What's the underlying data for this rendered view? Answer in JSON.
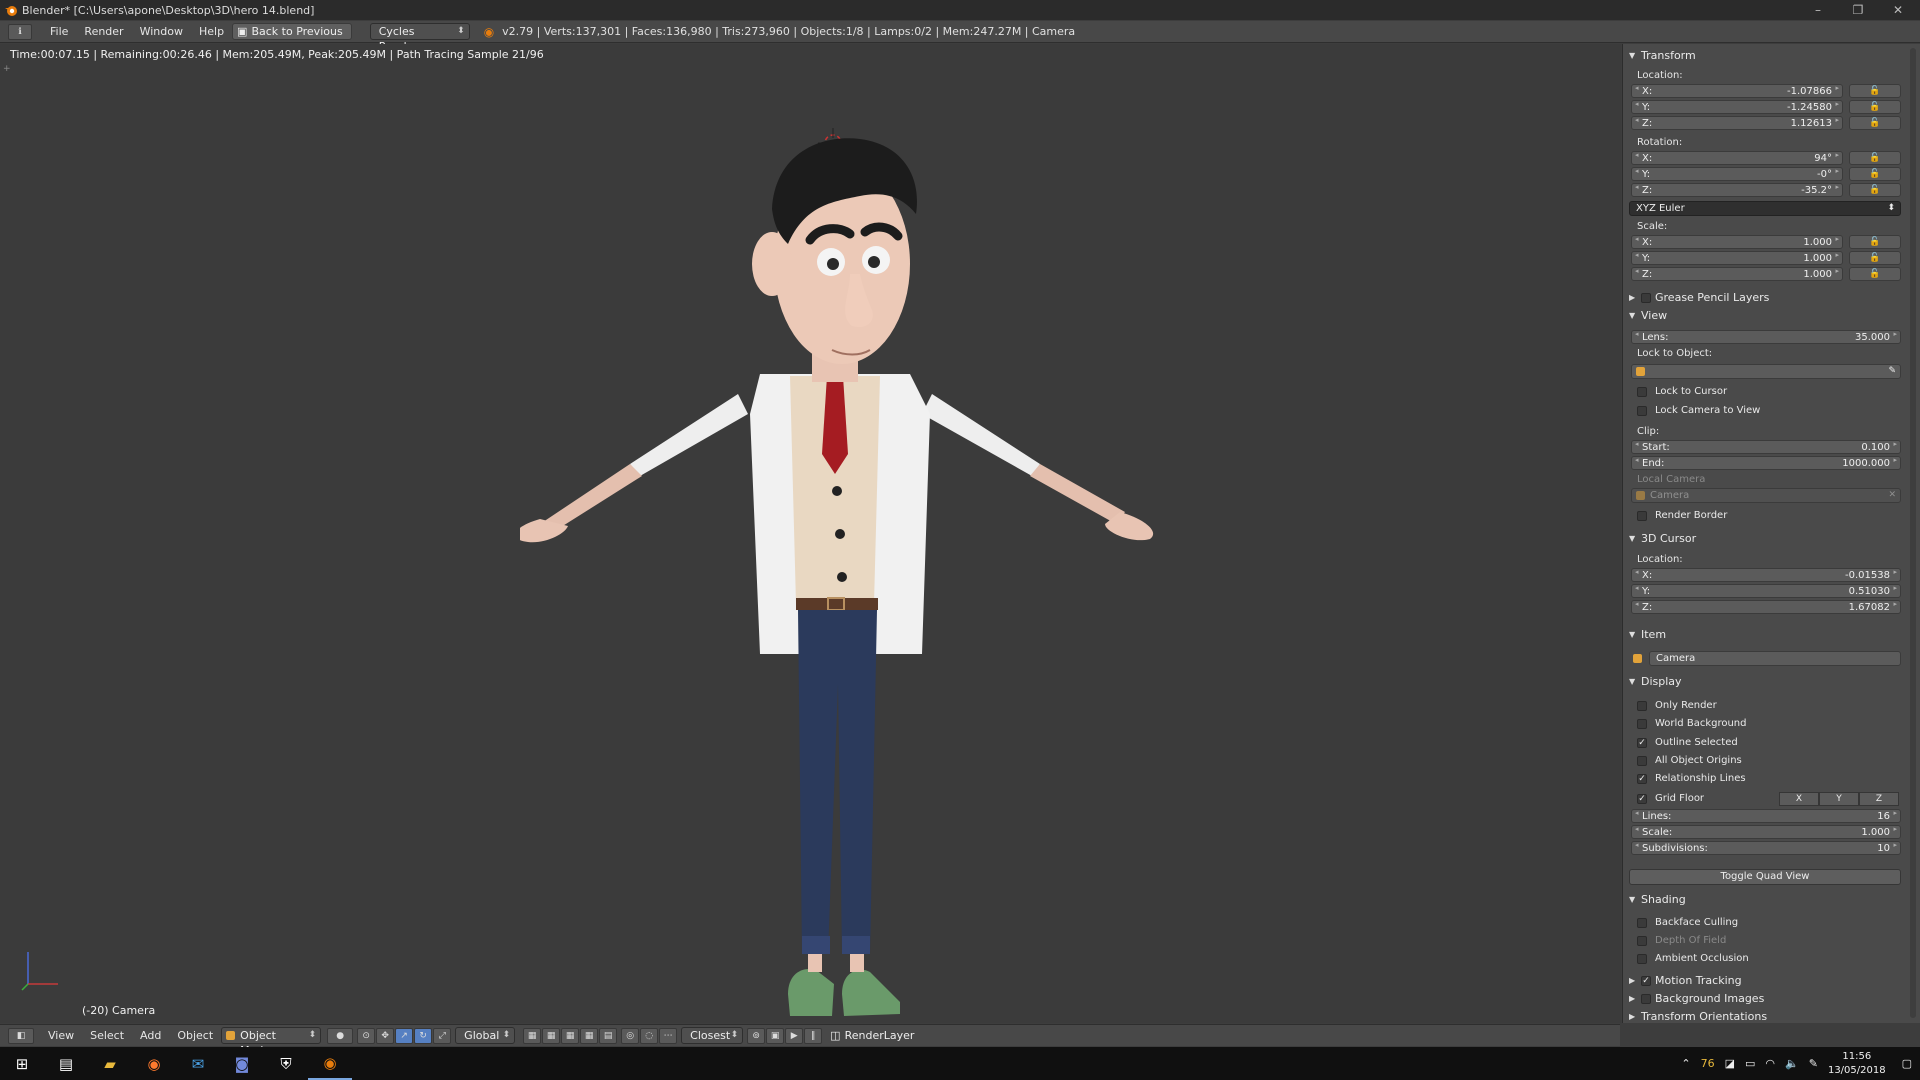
{
  "window": {
    "title": "Blender* [C:\\Users\\apone\\Desktop\\3D\\hero 14.blend]",
    "controls": [
      "–",
      "❐",
      "✕"
    ]
  },
  "header": {
    "menus": [
      "File",
      "Render",
      "Window",
      "Help"
    ],
    "back_button": "Back to Previous",
    "engine": "Cycles Render",
    "stats": "v2.79 | Verts:137,301 | Faces:136,980 | Tris:273,960 | Objects:1/8 | Lamps:0/2 | Mem:247.27M | Camera"
  },
  "viewport": {
    "render_status": "Time:00:07.15 | Remaining:00:26.46 | Mem:205.49M, Peak:205.49M | Path Tracing Sample 21/96",
    "view_name": "(-20) Camera"
  },
  "properties": {
    "transform": {
      "title": "Transform",
      "location_label": "Location:",
      "location": [
        {
          "axis": "X:",
          "value": "-1.07866"
        },
        {
          "axis": "Y:",
          "value": "-1.24580"
        },
        {
          "axis": "Z:",
          "value": "1.12613"
        }
      ],
      "rotation_label": "Rotation:",
      "rotation": [
        {
          "axis": "X:",
          "value": "94°"
        },
        {
          "axis": "Y:",
          "value": "-0°"
        },
        {
          "axis": "Z:",
          "value": "-35.2°"
        }
      ],
      "rotation_mode": "XYZ Euler",
      "scale_label": "Scale:",
      "scale": [
        {
          "axis": "X:",
          "value": "1.000"
        },
        {
          "axis": "Y:",
          "value": "1.000"
        },
        {
          "axis": "Z:",
          "value": "1.000"
        }
      ]
    },
    "grease_pencil": "Grease Pencil Layers",
    "view": {
      "title": "View",
      "lens_label": "Lens:",
      "lens": "35.000",
      "lock_to_object": "Lock to Object:",
      "lock_to_cursor": "Lock to Cursor",
      "lock_camera_to_view": "Lock Camera to View",
      "clip_label": "Clip:",
      "clip_start_label": "Start:",
      "clip_start": "0.100",
      "clip_end_label": "End:",
      "clip_end": "1000.000",
      "local_camera": "Local Camera",
      "local_camera_value": "Camera",
      "render_border": "Render Border"
    },
    "cursor": {
      "title": "3D Cursor",
      "location_label": "Location:",
      "location": [
        {
          "axis": "X:",
          "value": "-0.01538"
        },
        {
          "axis": "Y:",
          "value": "0.51030"
        },
        {
          "axis": "Z:",
          "value": "1.67082"
        }
      ]
    },
    "item": {
      "title": "Item",
      "name": "Camera"
    },
    "display": {
      "title": "Display",
      "only_render": "Only Render",
      "world_background": "World Background",
      "outline_selected": "Outline Selected",
      "all_object_origins": "All Object Origins",
      "relationship_lines": "Relationship Lines",
      "grid_floor": "Grid Floor",
      "axis_buttons": [
        "X",
        "Y",
        "Z"
      ],
      "lines_label": "Lines:",
      "lines": "16",
      "scale_label": "Scale:",
      "scale": "1.000",
      "subdivisions_label": "Subdivisions:",
      "subdivisions": "10",
      "toggle_quad_view": "Toggle Quad View"
    },
    "shading": {
      "title": "Shading",
      "backface_culling": "Backface Culling",
      "depth_of_field": "Depth Of Field",
      "ambient_occlusion": "Ambient Occlusion"
    },
    "motion_tracking": "Motion Tracking",
    "background_images": "Background Images",
    "transform_orientations": "Transform Orientations"
  },
  "bottom_header": {
    "menus": [
      "View",
      "Select",
      "Add",
      "Object"
    ],
    "mode": "Object Mode",
    "orientation": "Global",
    "snap": "Closest",
    "render_layer": "RenderLayer"
  },
  "taskbar": {
    "tray_number": "76",
    "time": "11:56",
    "date": "13/05/2018"
  },
  "colors": {
    "accent": "#5680c2",
    "object_icon": "#e2a33a"
  }
}
